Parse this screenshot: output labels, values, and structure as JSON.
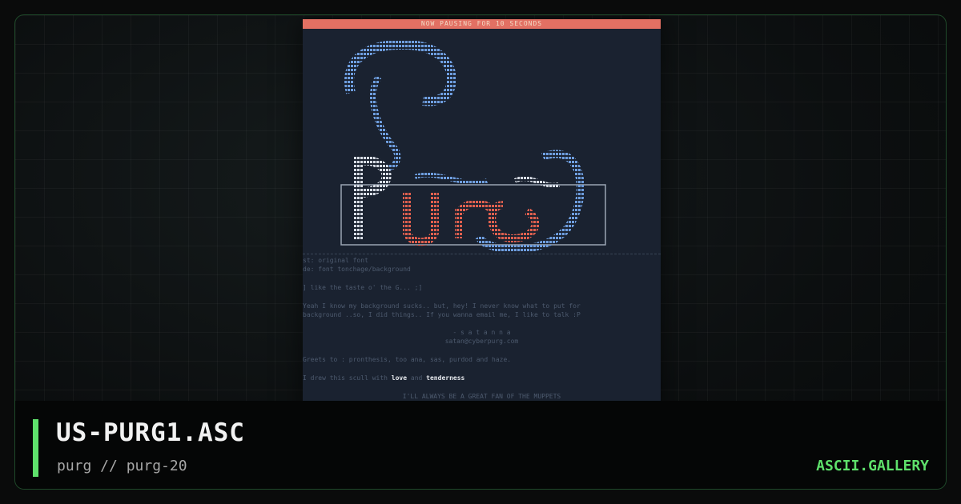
{
  "card": {
    "title": "US-PURG1.ASC",
    "subtitle": "purg // purg-20",
    "site": "ASCII.GALLERY"
  },
  "preview": {
    "banner": "NOW PAUSING FOR 10 SECONDS",
    "lines": [
      "st: original font",
      "de: font tonchage/background",
      "] like the taste o' the G... ;]",
      "Yeah  I know my background sucks.. but, hey!  I never know what to  put  for",
      "background ..so, I did things.. If you  wanna  email  me,  I  like to talk :P",
      "- s a t a n n a",
      "satan@cyberpurg.com",
      "Greets to : pronthesis, too ana, sas, purdod and haze.",
      "I drew this scull with",
      "love",
      "and",
      "tenderness",
      "I'LL ALWAYS BE A GREAT FAN OF THE MUPPETS"
    ]
  },
  "colors": {
    "accent": "#5ee06b",
    "banner": "#e27063",
    "art_blue": "#6f9fe0",
    "art_red": "#e0604f"
  }
}
